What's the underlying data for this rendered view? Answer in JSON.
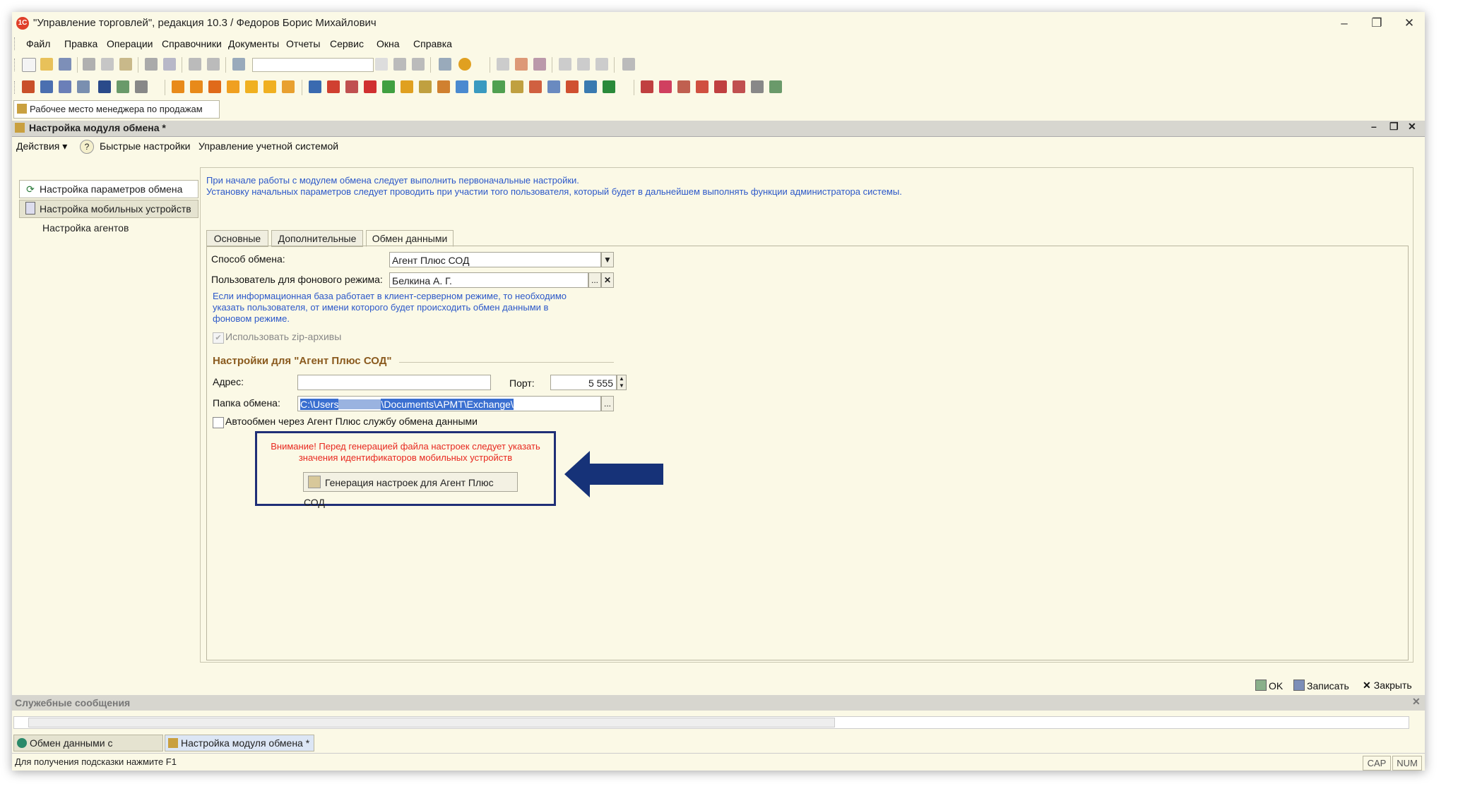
{
  "window": {
    "title": "\"Управление торговлей\", редакция 10.3 / Федоров Борис Михайлович",
    "app_icon_text": "1С",
    "minimize": "–",
    "restore": "❐",
    "close": "✕"
  },
  "menu": [
    "Файл",
    "Правка",
    "Операции",
    "Справочники",
    "Документы",
    "Отчеты",
    "Сервис",
    "Окна",
    "Справка"
  ],
  "manager_tab": "Рабочее место менеджера по продажам",
  "inner_window": {
    "title": "Настройка модуля обмена *",
    "actions_label": "Действия ▾",
    "help_glyph": "?",
    "quick_settings": "Быстрые настройки",
    "account_system": "Управление учетной системой"
  },
  "nav": [
    {
      "label": "Настройка параметров обмена",
      "icon": "refresh-icon"
    },
    {
      "label": "Настройка мобильных устройств",
      "icon": "mobile-device-icon"
    },
    {
      "label": "Настройка агентов",
      "icon": ""
    }
  ],
  "info": {
    "line1": "При начале работы с модулем обмена следует выполнить первоначальные настройки.",
    "line2": "Установку начальных параметров следует проводить при участии того пользователя, который будет в дальнейшем выполнять функции администратора системы."
  },
  "tabs": [
    "Основные",
    "Дополнительные",
    "Обмен данными"
  ],
  "form": {
    "exchange_method_label": "Способ обмена:",
    "exchange_method_value": "Агент Плюс СОД",
    "bg_user_label": "Пользователь для фонового режима:",
    "bg_user_value": "Белкина А. Г.",
    "bg_user_hint_1": "Если информационная база работает в клиент-серверном режиме, то необходимо",
    "bg_user_hint_2": "указать пользователя, от имени которого будет происходить обмен данными в",
    "bg_user_hint_3": "фоновом режиме.",
    "zip_label": "Использовать zip-архивы",
    "zip_checked": true,
    "group_title": "Настройки для \"Агент Плюс СОД\"",
    "address_label": "Адрес:",
    "address_value": "",
    "port_label": "Порт:",
    "port_value": "5 555",
    "folder_label": "Папка обмена:",
    "folder_value_a": "C:\\Users",
    "folder_value_b": "\\Documents\\АРМТ\\Exchange\\",
    "auto_exchange_label": "Автообмен через Агент Плюс службу обмена данными",
    "auto_exchange_checked": false,
    "warning_1": "Внимание! Перед генерацией файла настроек следует указать",
    "warning_2": "значения идентификаторов мобильных устройств",
    "generate_button": "Генерация настроек для Агент Плюс СОД",
    "ellipsis": "...",
    "clear": "✕",
    "dropdown": "▼"
  },
  "bottom_buttons": {
    "ok": "OK",
    "save": "Записать",
    "close": "Закрыть"
  },
  "service_messages": "Служебные сообщения",
  "taskbar": [
    "Обмен данными с мобильн...",
    "Настройка модуля обмена *"
  ],
  "status": {
    "hint": "Для получения подсказки нажмите F1",
    "cap": "CAP",
    "num": "NUM"
  },
  "colors": {
    "window_bg": "#fbf9e6",
    "info_text": "#2c58c9",
    "warning": "#e8281f",
    "group_title": "#8a5a1e",
    "highlight_box": "#1f2f77",
    "arrow": "#163278"
  }
}
